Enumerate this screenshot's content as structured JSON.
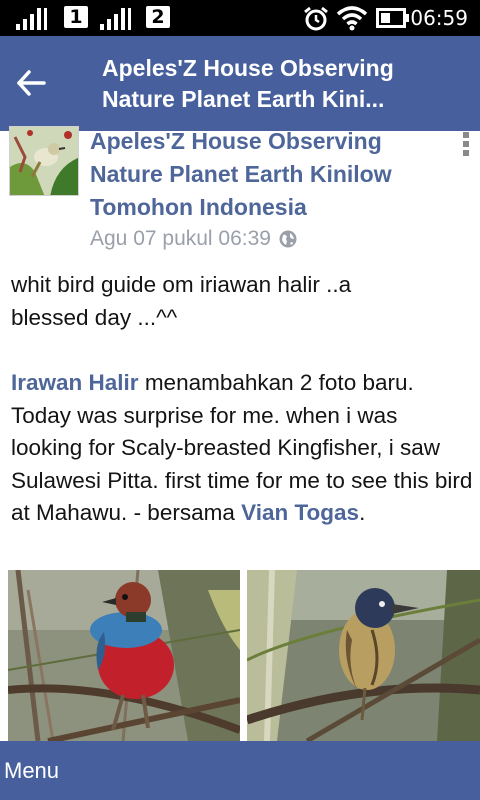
{
  "status_bar": {
    "sim1": "1",
    "sim2": "2",
    "time": "06:59",
    "icons": [
      "signal-icon",
      "signal-icon",
      "alarm-icon",
      "wifi-icon",
      "battery-icon"
    ]
  },
  "header": {
    "title_line1": "Apeles'Z House Observing",
    "title_line2": "Nature Planet Earth Kini...",
    "back_icon": "arrow-left-icon",
    "color": "#47609d"
  },
  "post": {
    "page_name_line1": "Apeles'Z House Observing",
    "page_name_line2": "Nature Planet Earth Kinilow",
    "page_name_line3": "Tomohon Indonesia",
    "timestamp": "Agu 07 pukul 06:39",
    "audience_icon": "globe-icon",
    "more_icon": "more-vertical-icon",
    "text_line1": "whit bird guide om iriawan halir ..a",
    "text_line2": "blessed day ...^^",
    "shared_author": "Irawan Halir",
    "shared_text": " menambahkan 2 foto baru. Today was surprise for me. when i was looking for Scaly-breasted Kingfisher, i saw Sulawesi Pitta. first time for me to see this bird at Mahawu. - bersama ",
    "tagged_user": "Vian Togas",
    "tail": ".",
    "link_color": "#4e6699",
    "photos": [
      {
        "subject": "pitta-bird-photo"
      },
      {
        "subject": "kingfisher-bird-photo"
      }
    ]
  },
  "bottom_bar": {
    "menu_label": "Menu"
  }
}
